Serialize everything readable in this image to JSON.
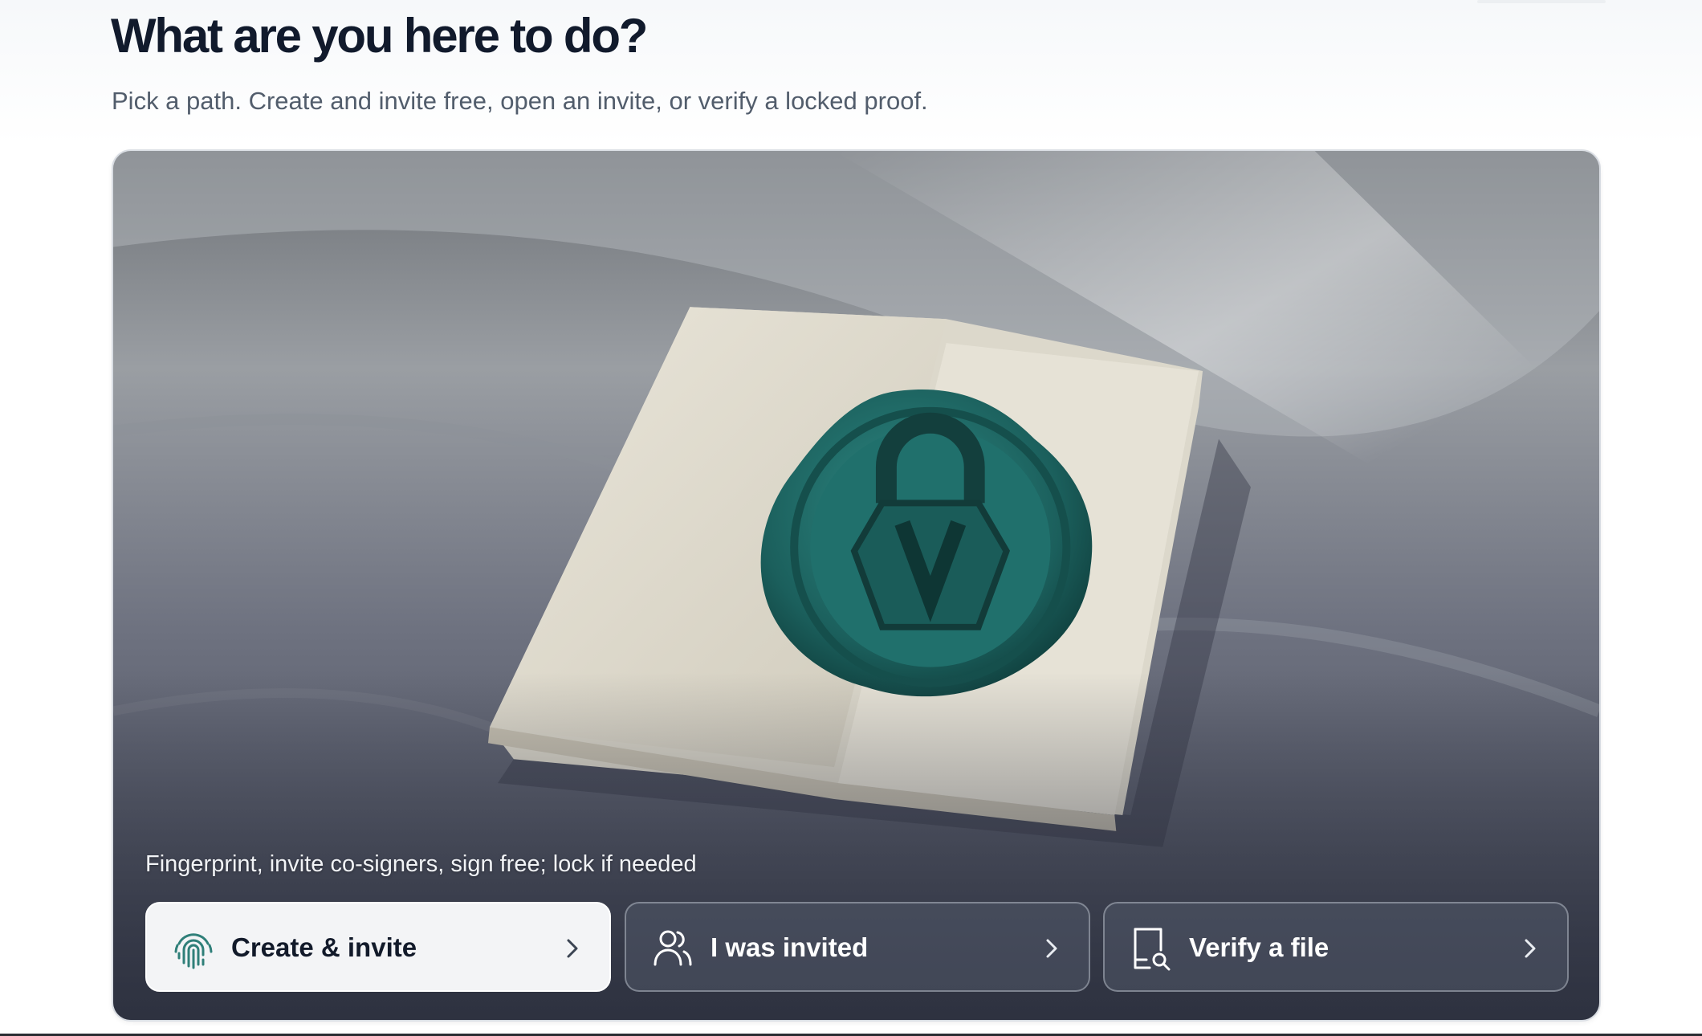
{
  "header": {
    "title": "What are you here to do?",
    "subtitle": "Pick a path. Create and invite free, open an invite, or verify a locked proof."
  },
  "hero": {
    "image_description_icon": "wax-seal-lock-icon",
    "caption": "Fingerprint, invite co-signers, sign free; lock if needed"
  },
  "actions": [
    {
      "label": "Create & invite",
      "icon": "fingerprint-icon",
      "selected": true
    },
    {
      "label": "I was invited",
      "icon": "users-icon",
      "selected": false
    },
    {
      "label": "Verify a file",
      "icon": "file-search-icon",
      "selected": false
    }
  ],
  "colors": {
    "accent": "#1f6b68",
    "title": "#111a2c",
    "subtitle": "#525d6c"
  }
}
